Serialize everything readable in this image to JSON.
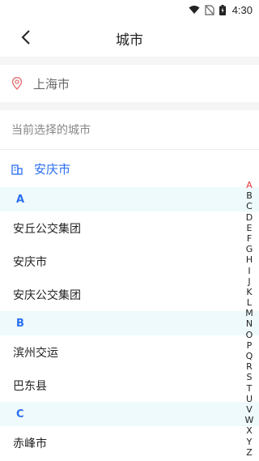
{
  "status": {
    "time": "4:30"
  },
  "header": {
    "title": "城市"
  },
  "location": {
    "text": "上海市"
  },
  "current": {
    "label": "当前选择的城市",
    "selected": "安庆市"
  },
  "groups": [
    {
      "letter": "A",
      "items": [
        "安丘公交集团",
        "安庆市",
        "安庆公交集团"
      ]
    },
    {
      "letter": "B",
      "items": [
        "滨州交运",
        "巴东县"
      ]
    },
    {
      "letter": "C",
      "items": [
        "赤峰市"
      ]
    }
  ],
  "index": [
    "A",
    "B",
    "C",
    "D",
    "E",
    "F",
    "G",
    "H",
    "I",
    "J",
    "K",
    "L",
    "M",
    "N",
    "O",
    "P",
    "Q",
    "R",
    "S",
    "T",
    "U",
    "V",
    "W",
    "X",
    "Y",
    "Z"
  ],
  "active_index": "A",
  "colors": {
    "accent": "#2b6ff0",
    "pin": "#e57373",
    "index_active": "#e53935",
    "group_bg": "#eefafc"
  }
}
